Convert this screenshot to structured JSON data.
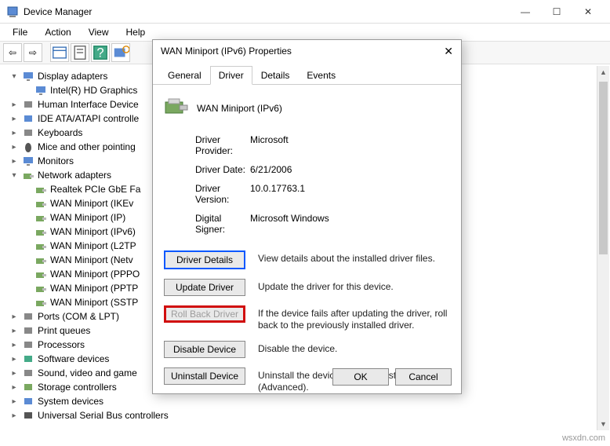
{
  "window": {
    "title": "Device Manager"
  },
  "menu": {
    "file": "File",
    "action": "Action",
    "view": "View",
    "help": "Help"
  },
  "tree": {
    "items": [
      {
        "lvl": 1,
        "exp": "▾",
        "label": "Display adapters",
        "i": "display"
      },
      {
        "lvl": 2,
        "exp": "",
        "label": "Intel(R) HD Graphics",
        "i": "display"
      },
      {
        "lvl": 1,
        "exp": "▸",
        "label": "Human Interface Device",
        "i": "hid"
      },
      {
        "lvl": 1,
        "exp": "▸",
        "label": "IDE ATA/ATAPI controlle",
        "i": "ide"
      },
      {
        "lvl": 1,
        "exp": "▸",
        "label": "Keyboards",
        "i": "kb"
      },
      {
        "lvl": 1,
        "exp": "▸",
        "label": "Mice and other pointing",
        "i": "mouse"
      },
      {
        "lvl": 1,
        "exp": "▸",
        "label": "Monitors",
        "i": "display"
      },
      {
        "lvl": 1,
        "exp": "▾",
        "label": "Network adapters",
        "i": "net"
      },
      {
        "lvl": 2,
        "exp": "",
        "label": "Realtek PCIe GbE Fa",
        "i": "net"
      },
      {
        "lvl": 2,
        "exp": "",
        "label": "WAN Miniport (IKEv",
        "i": "net"
      },
      {
        "lvl": 2,
        "exp": "",
        "label": "WAN Miniport (IP)",
        "i": "net"
      },
      {
        "lvl": 2,
        "exp": "",
        "label": "WAN Miniport (IPv6)",
        "i": "net"
      },
      {
        "lvl": 2,
        "exp": "",
        "label": "WAN Miniport (L2TP",
        "i": "net"
      },
      {
        "lvl": 2,
        "exp": "",
        "label": "WAN Miniport (Netv",
        "i": "net"
      },
      {
        "lvl": 2,
        "exp": "",
        "label": "WAN Miniport (PPPO",
        "i": "net"
      },
      {
        "lvl": 2,
        "exp": "",
        "label": "WAN Miniport (PPTP",
        "i": "net"
      },
      {
        "lvl": 2,
        "exp": "",
        "label": "WAN Miniport (SSTP",
        "i": "net"
      },
      {
        "lvl": 1,
        "exp": "▸",
        "label": "Ports (COM & LPT)",
        "i": "port"
      },
      {
        "lvl": 1,
        "exp": "▸",
        "label": "Print queues",
        "i": "print"
      },
      {
        "lvl": 1,
        "exp": "▸",
        "label": "Processors",
        "i": "cpu"
      },
      {
        "lvl": 1,
        "exp": "▸",
        "label": "Software devices",
        "i": "sw"
      },
      {
        "lvl": 1,
        "exp": "▸",
        "label": "Sound, video and game",
        "i": "snd"
      },
      {
        "lvl": 1,
        "exp": "▸",
        "label": "Storage controllers",
        "i": "stor"
      },
      {
        "lvl": 1,
        "exp": "▸",
        "label": "System devices",
        "i": "sys"
      },
      {
        "lvl": 1,
        "exp": "▸",
        "label": "Universal Serial Bus controllers",
        "i": "usb"
      }
    ]
  },
  "dialog": {
    "title": "WAN Miniport (IPv6) Properties",
    "tabs": {
      "general": "General",
      "driver": "Driver",
      "details": "Details",
      "events": "Events"
    },
    "device": "WAN Miniport (IPv6)",
    "rows": {
      "provider_l": "Driver Provider:",
      "provider_v": "Microsoft",
      "date_l": "Driver Date:",
      "date_v": "6/21/2006",
      "version_l": "Driver Version:",
      "version_v": "10.0.17763.1",
      "signer_l": "Digital Signer:",
      "signer_v": "Microsoft Windows"
    },
    "buttons": {
      "details": "Driver Details",
      "details_d": "View details about the installed driver files.",
      "update": "Update Driver",
      "update_d": "Update the driver for this device.",
      "rollback": "Roll Back Driver",
      "rollback_d": "If the device fails after updating the driver, roll back to the previously installed driver.",
      "disable": "Disable Device",
      "disable_d": "Disable the device.",
      "uninstall": "Uninstall Device",
      "uninstall_d": "Uninstall the device from the system (Advanced)."
    },
    "ok": "OK",
    "cancel": "Cancel"
  },
  "watermark": "wsxdn.com"
}
